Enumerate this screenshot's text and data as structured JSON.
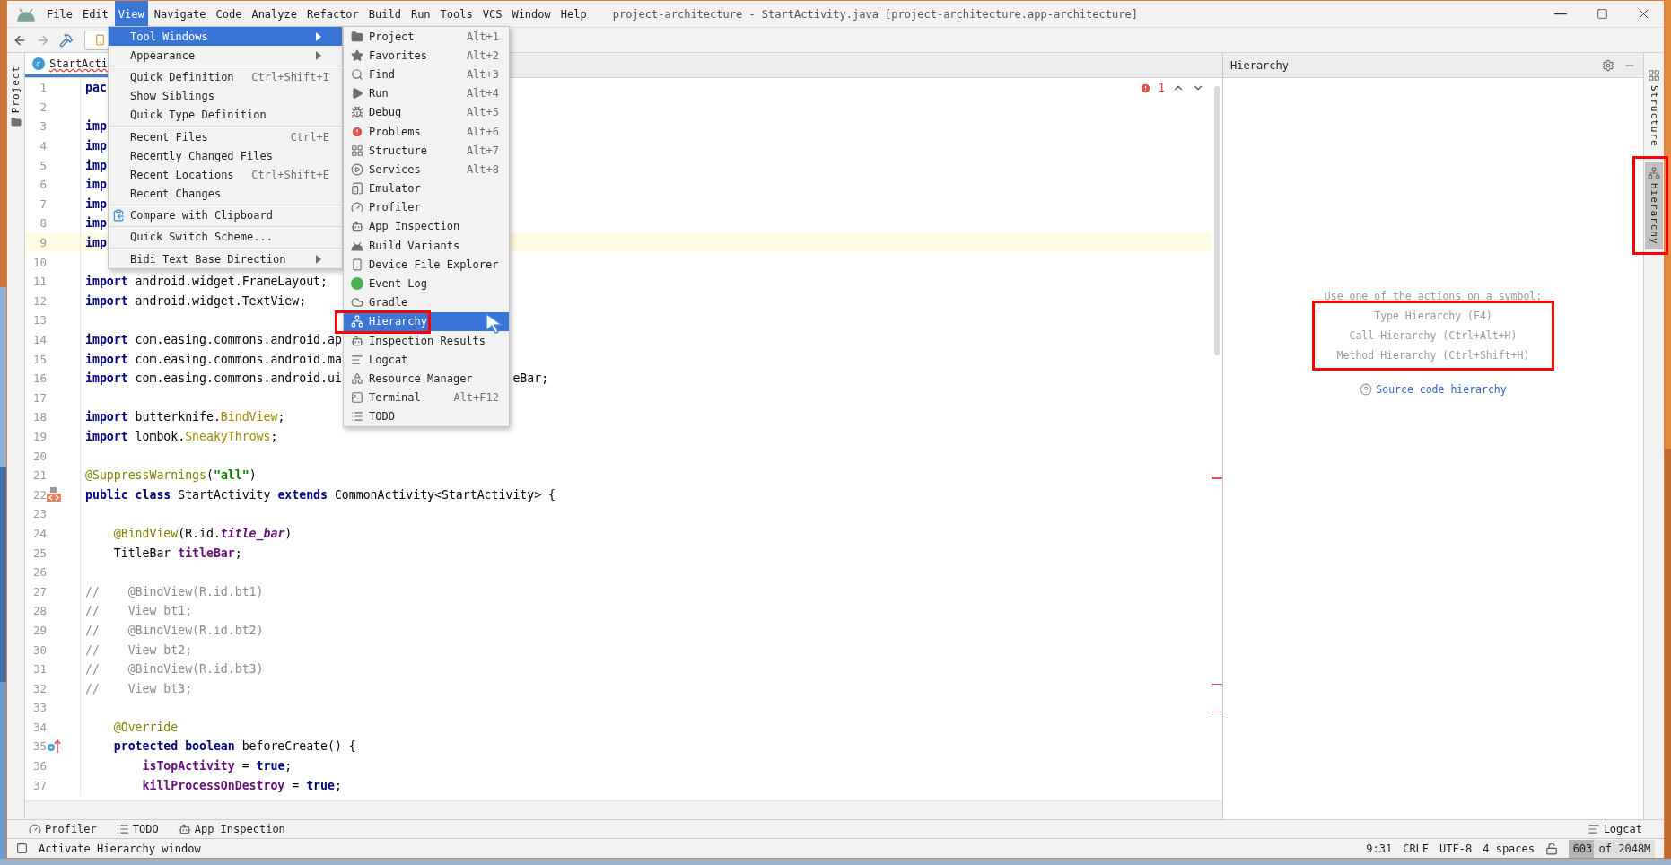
{
  "window": {
    "title": "project-architecture - StartActivity.java [project-architecture.app-architecture]"
  },
  "menu_bar": [
    {
      "label": "File",
      "selected": false
    },
    {
      "label": "Edit",
      "selected": false
    },
    {
      "label": "View",
      "selected": true
    },
    {
      "label": "Navigate",
      "selected": false
    },
    {
      "label": "Code",
      "selected": false
    },
    {
      "label": "Analyze",
      "selected": false
    },
    {
      "label": "Refactor",
      "selected": false
    },
    {
      "label": "Build",
      "selected": false
    },
    {
      "label": "Run",
      "selected": false
    },
    {
      "label": "Tools",
      "selected": false
    },
    {
      "label": "VCS",
      "selected": false
    },
    {
      "label": "Window",
      "selected": false
    },
    {
      "label": "Help",
      "selected": false
    }
  ],
  "view_menu": [
    {
      "kind": "item",
      "label": "Tool Windows",
      "submenu": true,
      "selected": true
    },
    {
      "kind": "item",
      "label": "Appearance",
      "submenu": true,
      "selected": false
    },
    {
      "kind": "separator"
    },
    {
      "kind": "item",
      "label": "Quick Definition",
      "shortcut": "Ctrl+Shift+I",
      "submenu": false,
      "selected": false
    },
    {
      "kind": "item",
      "label": "Show Siblings",
      "submenu": false,
      "selected": false
    },
    {
      "kind": "item",
      "label": "Quick Type Definition",
      "submenu": false,
      "selected": false
    },
    {
      "kind": "separator"
    },
    {
      "kind": "item",
      "label": "Recent Files",
      "shortcut": "Ctrl+E",
      "submenu": false,
      "selected": false
    },
    {
      "kind": "item",
      "label": "Recently Changed Files",
      "submenu": false,
      "selected": false
    },
    {
      "kind": "item",
      "label": "Recent Locations",
      "shortcut": "Ctrl+Shift+E",
      "submenu": false,
      "selected": false
    },
    {
      "kind": "item",
      "label": "Recent Changes",
      "submenu": false,
      "selected": false
    },
    {
      "kind": "separator"
    },
    {
      "kind": "icon-item",
      "label": "Compare with Clipboard",
      "submenu": false,
      "selected": false
    },
    {
      "kind": "separator"
    },
    {
      "kind": "item",
      "label": "Quick Switch Scheme...",
      "submenu": false,
      "selected": false
    },
    {
      "kind": "separator"
    },
    {
      "kind": "item",
      "label": "Bidi Text Base Direction",
      "submenu": true,
      "selected": false
    }
  ],
  "tool_windows_menu": [
    {
      "label": "Project",
      "shortcut": "Alt+1",
      "selected": false,
      "annotated": false
    },
    {
      "label": "Favorites",
      "shortcut": "Alt+2",
      "selected": false,
      "annotated": false
    },
    {
      "label": "Find",
      "shortcut": "Alt+3",
      "selected": false,
      "annotated": false
    },
    {
      "label": "Run",
      "shortcut": "Alt+4",
      "selected": false,
      "annotated": false
    },
    {
      "label": "Debug",
      "shortcut": "Alt+5",
      "selected": false,
      "annotated": false
    },
    {
      "label": "Problems",
      "shortcut": "Alt+6",
      "selected": false,
      "annotated": false
    },
    {
      "label": "Structure",
      "shortcut": "Alt+7",
      "selected": false,
      "annotated": false
    },
    {
      "label": "Services",
      "shortcut": "Alt+8",
      "selected": false,
      "annotated": false
    },
    {
      "label": "Emulator",
      "selected": false,
      "annotated": false
    },
    {
      "label": "Profiler",
      "selected": false,
      "annotated": false
    },
    {
      "label": "App Inspection",
      "selected": false,
      "annotated": false
    },
    {
      "label": "Build Variants",
      "selected": false,
      "annotated": false
    },
    {
      "label": "Device File Explorer",
      "selected": false,
      "annotated": false
    },
    {
      "label": "Event Log",
      "selected": false,
      "annotated": false
    },
    {
      "label": "Gradle",
      "selected": false,
      "annotated": false
    },
    {
      "label": "Hierarchy",
      "selected": true,
      "annotated": true
    },
    {
      "label": "Inspection Results",
      "selected": false,
      "annotated": false
    },
    {
      "label": "Logcat",
      "selected": false,
      "annotated": false
    },
    {
      "label": "Resource Manager",
      "selected": false,
      "annotated": false
    },
    {
      "label": "Terminal",
      "shortcut": "Alt+F12",
      "selected": false,
      "annotated": false
    },
    {
      "label": "TODO",
      "selected": false,
      "annotated": false
    }
  ],
  "left_strip": {
    "tabs": [
      {
        "label": "Project",
        "selected": false
      }
    ]
  },
  "editor": {
    "tab": {
      "icon_letter": "c",
      "label": "StartActi",
      "error": true
    },
    "problems": "1",
    "lines": [
      {
        "number": "1",
        "kind": "code",
        "current": false,
        "tokens": [
          {
            "kind": "kw",
            "text": "pac"
          }
        ]
      },
      {
        "number": "2",
        "kind": "code",
        "current": false
      },
      {
        "number": "3",
        "kind": "code",
        "current": false,
        "tokens": [
          {
            "kind": "kw",
            "text": "imp"
          }
        ]
      },
      {
        "number": "4",
        "kind": "code",
        "current": false,
        "tokens": [
          {
            "kind": "kw",
            "text": "imp"
          }
        ]
      },
      {
        "number": "5",
        "kind": "code",
        "current": false,
        "tokens": [
          {
            "kind": "kw",
            "text": "imp"
          }
        ]
      },
      {
        "number": "6",
        "kind": "code",
        "current": false,
        "tokens": [
          {
            "kind": "kw",
            "text": "imp"
          }
        ]
      },
      {
        "number": "7",
        "kind": "code",
        "current": false,
        "tokens": [
          {
            "kind": "kw",
            "text": "imp"
          }
        ]
      },
      {
        "number": "8",
        "kind": "code",
        "current": false,
        "tokens": [
          {
            "kind": "kw",
            "text": "imp"
          }
        ]
      },
      {
        "number": "9",
        "kind": "code",
        "current": true,
        "tokens": [
          {
            "kind": "kw",
            "text": "imp"
          }
        ]
      },
      {
        "number": "10",
        "kind": "code",
        "current": false
      },
      {
        "number": "11",
        "kind": "code",
        "current": false,
        "tokens": [
          {
            "kind": "kw",
            "text": "import"
          },
          {
            "kind": "plain",
            "text": " android.widget.FrameLayout;"
          }
        ]
      },
      {
        "number": "12",
        "kind": "code",
        "current": false,
        "tokens": [
          {
            "kind": "kw",
            "text": "import"
          },
          {
            "kind": "plain",
            "text": " android.widget.TextView;"
          }
        ]
      },
      {
        "number": "13",
        "kind": "code",
        "current": false
      },
      {
        "number": "14",
        "kind": "code",
        "current": false,
        "tokens": [
          {
            "kind": "kw",
            "text": "import"
          },
          {
            "kind": "plain",
            "text": " com.easing.commons.android.ap"
          }
        ]
      },
      {
        "number": "15",
        "kind": "code",
        "current": false,
        "tokens": [
          {
            "kind": "kw",
            "text": "import"
          },
          {
            "kind": "plain",
            "text": " com.easing.commons.android.ma"
          }
        ]
      },
      {
        "number": "16",
        "kind": "code",
        "current": false,
        "tokens": [
          {
            "kind": "kw",
            "text": "import"
          },
          {
            "kind": "plain",
            "text": " com.easing.commons.android.ui"
          },
          {
            "kind": "tail",
            "text": "eBar;"
          }
        ]
      },
      {
        "number": "17",
        "kind": "code",
        "current": false
      },
      {
        "number": "18",
        "kind": "code",
        "current": false,
        "tokens": [
          {
            "kind": "kw",
            "text": "import"
          },
          {
            "kind": "plain",
            "text": " butterknife."
          },
          {
            "kind": "ref",
            "text": "BindView"
          },
          {
            "kind": "plain",
            "text": ";"
          }
        ]
      },
      {
        "number": "19",
        "kind": "code",
        "current": false,
        "tokens": [
          {
            "kind": "kw",
            "text": "import"
          },
          {
            "kind": "plain",
            "text": " lombok."
          },
          {
            "kind": "ref",
            "text": "SneakyThrows"
          },
          {
            "kind": "plain",
            "text": ";"
          }
        ]
      },
      {
        "number": "20",
        "kind": "code",
        "current": false
      },
      {
        "number": "21",
        "kind": "code",
        "current": false,
        "tokens": [
          {
            "kind": "ann",
            "text": "@SuppressWarnings"
          },
          {
            "kind": "plain",
            "text": "("
          },
          {
            "kind": "str",
            "text": "\"all\""
          },
          {
            "kind": "plain",
            "text": ")"
          }
        ]
      },
      {
        "number": "22",
        "kind": "class",
        "current": false,
        "tokens": [
          {
            "kind": "kw",
            "text": "public class"
          },
          {
            "kind": "plain",
            "text": " StartActivity "
          },
          {
            "kind": "kw",
            "text": "extends"
          },
          {
            "kind": "plain",
            "text": " CommonActivity<StartActivity> {"
          }
        ]
      },
      {
        "number": "23",
        "kind": "code",
        "current": false
      },
      {
        "number": "24",
        "kind": "code",
        "current": false,
        "tokens": [
          {
            "kind": "ann",
            "text": "    @BindView"
          },
          {
            "kind": "plain",
            "text": "(R.id."
          },
          {
            "kind": "ifield",
            "text": "title_bar"
          },
          {
            "kind": "plain",
            "text": ")"
          }
        ]
      },
      {
        "number": "25",
        "kind": "code",
        "current": false,
        "tokens": [
          {
            "kind": "plain",
            "text": "    TitleBar "
          },
          {
            "kind": "field",
            "text": "titleBar"
          },
          {
            "kind": "plain",
            "text": ";"
          }
        ]
      },
      {
        "number": "26",
        "kind": "code",
        "current": false
      },
      {
        "number": "27",
        "kind": "code",
        "current": false,
        "tokens": [
          {
            "kind": "comment",
            "text": "//    @BindView(R.id.bt1)"
          }
        ]
      },
      {
        "number": "28",
        "kind": "code",
        "current": false,
        "tokens": [
          {
            "kind": "comment",
            "text": "//    View bt1;"
          }
        ]
      },
      {
        "number": "29",
        "kind": "code",
        "current": false,
        "tokens": [
          {
            "kind": "comment",
            "text": "//    @BindView(R.id.bt2)"
          }
        ]
      },
      {
        "number": "30",
        "kind": "code",
        "current": false,
        "tokens": [
          {
            "kind": "comment",
            "text": "//    View bt2;"
          }
        ]
      },
      {
        "number": "31",
        "kind": "code",
        "current": false,
        "tokens": [
          {
            "kind": "comment",
            "text": "//    @BindView(R.id.bt3)"
          }
        ]
      },
      {
        "number": "32",
        "kind": "code",
        "current": false,
        "tokens": [
          {
            "kind": "comment",
            "text": "//    View bt3;"
          }
        ]
      },
      {
        "number": "33",
        "kind": "code",
        "current": false
      },
      {
        "number": "34",
        "kind": "code",
        "current": false,
        "tokens": [
          {
            "kind": "ann",
            "text": "    @Override"
          }
        ]
      },
      {
        "number": "35",
        "kind": "override",
        "current": false,
        "tokens": [
          {
            "kind": "kw",
            "text": "    protected boolean"
          },
          {
            "kind": "plain",
            "text": " beforeCreate() {"
          }
        ]
      },
      {
        "number": "36",
        "kind": "code",
        "current": false,
        "tokens": [
          {
            "kind": "field",
            "text": "        isTopActivity"
          },
          {
            "kind": "plain",
            "text": " = "
          },
          {
            "kind": "kw",
            "text": "true"
          },
          {
            "kind": "plain",
            "text": ";"
          }
        ]
      },
      {
        "number": "37",
        "kind": "code",
        "current": false,
        "tokens": [
          {
            "kind": "field",
            "text": "        killProcessOnDestroy"
          },
          {
            "kind": "plain",
            "text": " = "
          },
          {
            "kind": "kw",
            "text": "true"
          },
          {
            "kind": "plain",
            "text": ";"
          }
        ]
      }
    ]
  },
  "hierarchy_panel": {
    "title": "Hierarchy",
    "prompt": "Use one of the actions on a symbol:",
    "actions": [
      "Type Hierarchy (F4)",
      "Call Hierarchy (Ctrl+Alt+H)",
      "Method Hierarchy (Ctrl+Shift+H)"
    ],
    "actions_annotated": true,
    "link": "Source code hierarchy"
  },
  "right_strip": {
    "tabs": [
      {
        "label": "Structure",
        "selected": false,
        "annotated": false
      },
      {
        "label": "Hierarchy",
        "selected": true,
        "annotated": true
      }
    ]
  },
  "bottom_bar": {
    "left": [
      {
        "label": "Profiler"
      },
      {
        "label": "TODO"
      },
      {
        "label": "App Inspection"
      }
    ],
    "right": [
      {
        "label": "Logcat"
      }
    ]
  },
  "status_bar": {
    "message": "Activate Hierarchy window",
    "position": "9:31",
    "line_separator": "CRLF",
    "encoding": "UTF-8",
    "indent": "4 spaces",
    "memory": {
      "text": "603 of 2048M",
      "level": 0.29
    }
  }
}
